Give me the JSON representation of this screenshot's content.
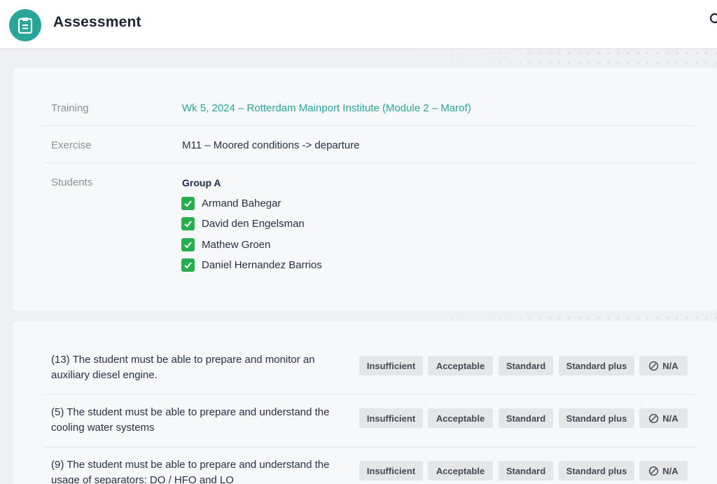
{
  "header": {
    "title": "Assessment",
    "icon": "clipboard-icon",
    "accent_color": "#2aa59a"
  },
  "info": {
    "training_label": "Training",
    "training_value": "Wk 5, 2024 – Rotterdam Mainport Institute (Module 2 – Marof)",
    "exercise_label": "Exercise",
    "exercise_value": "M11 – Moored conditions -> departure",
    "students_label": "Students",
    "group_title": "Group A",
    "students": [
      "Armand Bahegar",
      "David den Engelsman",
      "Mathew Groen",
      "Daniel Hernandez Barrios"
    ]
  },
  "rating_options": [
    "Insufficient",
    "Acceptable",
    "Standard",
    "Standard plus",
    "N/A"
  ],
  "criteria": [
    {
      "text": "(13) The student must be able to prepare and monitor an auxiliary diesel engine."
    },
    {
      "text": "(5) The student must be able to prepare and understand the cooling water systems"
    },
    {
      "text": "(9) The student must be able to prepare and understand the usage of separators: DO / HFO and LO"
    }
  ]
}
